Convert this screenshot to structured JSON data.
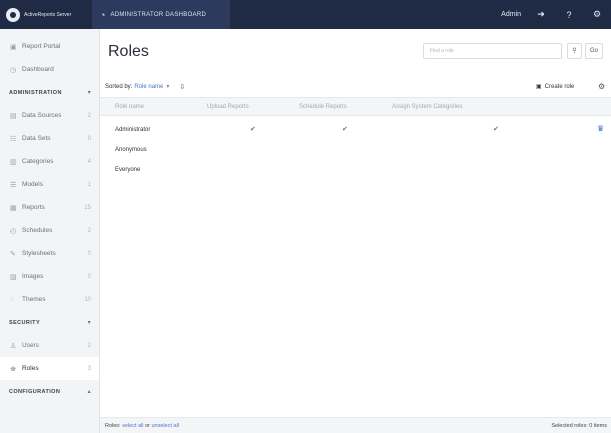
{
  "app": {
    "brand": "ActiveReports Server",
    "admin_tab": "ADMINISTRATOR DASHBOARD",
    "user": "Admin",
    "help": "?"
  },
  "sidebar": {
    "top_items": [
      {
        "label": "Report Portal",
        "icon": "portal-icon"
      },
      {
        "label": "Dashboard",
        "icon": "dashboard-icon"
      }
    ],
    "sections": [
      {
        "header": "ADMINISTRATION",
        "collapse": "▾",
        "items": [
          {
            "label": "Data Sources",
            "count": "2",
            "icon": "database-icon"
          },
          {
            "label": "Data Sets",
            "count": "0",
            "icon": "table-icon"
          },
          {
            "label": "Categories",
            "count": "4",
            "icon": "tags-icon"
          },
          {
            "label": "Models",
            "count": "1",
            "icon": "list-icon"
          },
          {
            "label": "Reports",
            "count": "15",
            "icon": "report-icon"
          },
          {
            "label": "Schedules",
            "count": "2",
            "icon": "clock-icon"
          },
          {
            "label": "Stylesheets",
            "count": "0",
            "icon": "brush-icon"
          },
          {
            "label": "Images",
            "count": "0",
            "icon": "image-icon"
          },
          {
            "label": "Themes",
            "count": "10",
            "icon": "theme-icon"
          }
        ]
      },
      {
        "header": "SECURITY",
        "collapse": "▾",
        "items": [
          {
            "label": "Users",
            "count": "2",
            "icon": "user-icon"
          },
          {
            "label": "Roles",
            "count": "3",
            "icon": "roles-icon",
            "active": true
          }
        ]
      },
      {
        "header": "CONFIGURATION",
        "collapse": "▴",
        "items": []
      }
    ]
  },
  "main": {
    "title": "Roles",
    "search_placeholder": "Find a role",
    "filter_label": "⚲",
    "go_label": "Go",
    "sort_label": "Sorted by:",
    "sort_value": "Role name",
    "create_role": "Create role",
    "columns": [
      "Role name",
      "Upload Reports",
      "Schedule Reports",
      "Assign System Categories"
    ],
    "rows": [
      {
        "name": "Administrator",
        "upload": "✔",
        "schedule": "✔",
        "assign": "✔"
      },
      {
        "name": "Anonymous",
        "upload": "",
        "schedule": "",
        "assign": ""
      },
      {
        "name": "Everyone",
        "upload": "",
        "schedule": "",
        "assign": ""
      }
    ],
    "footer": {
      "prefix": "Roles:",
      "select_all": "select all",
      "or": "or",
      "unselect_all": "unselect all",
      "selected": "Selected roles: 0 items"
    }
  }
}
